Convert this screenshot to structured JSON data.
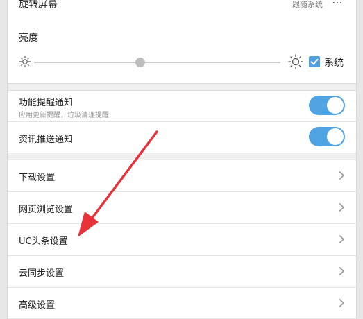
{
  "rotate": {
    "title": "旋转屏幕",
    "value": "跟随系统",
    "more_icon": "⋯"
  },
  "brightness": {
    "title": "亮度",
    "level": 0.43,
    "system_label": "系统",
    "system_checked": true
  },
  "notifications": [
    {
      "title": "功能提醒通知",
      "subtitle": "应用更新提醒，垃圾清理提醒",
      "enabled": true
    },
    {
      "title": "资讯推送通知",
      "subtitle": "",
      "enabled": true
    }
  ],
  "menu": [
    {
      "label": "下载设置"
    },
    {
      "label": "网页浏览设置"
    },
    {
      "label": "UC头条设置"
    },
    {
      "label": "云同步设置"
    },
    {
      "label": "高级设置"
    }
  ],
  "colors": {
    "accent": "#4fa3e2",
    "annotation": "#e8323a"
  }
}
